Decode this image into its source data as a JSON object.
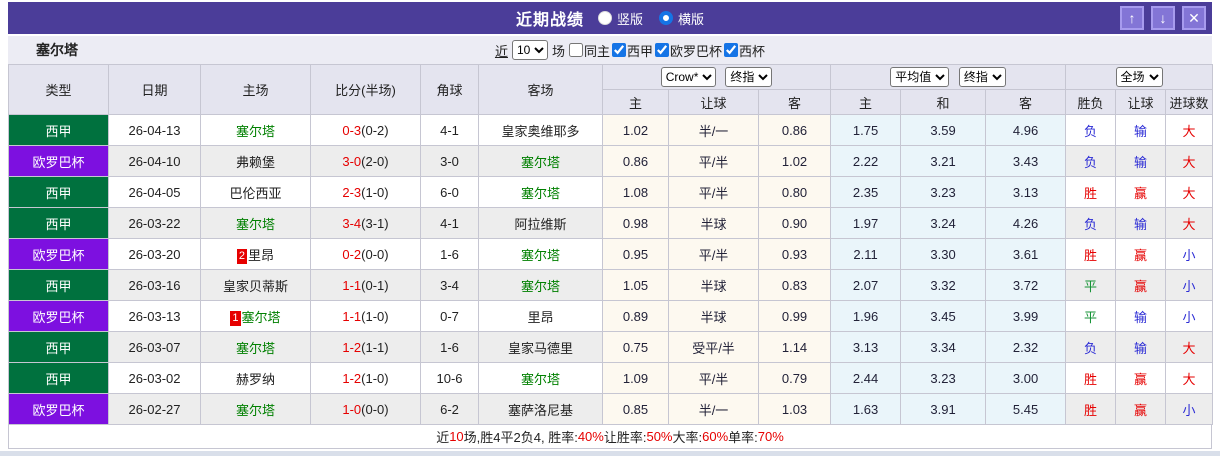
{
  "titlebar": {
    "title": "近期战绩",
    "radios": [
      {
        "label": "竖版",
        "checked": false
      },
      {
        "label": "横版",
        "checked": true
      }
    ],
    "buttons": {
      "up": "↑",
      "down": "↓",
      "close": "✕"
    }
  },
  "filter": {
    "team": "塞尔塔",
    "recent_label": "近",
    "recent_value": "10",
    "games_label": "场",
    "checkboxes": [
      {
        "label": "同主",
        "checked": false
      },
      {
        "label": "西甲",
        "checked": true
      },
      {
        "label": "欧罗巴杯",
        "checked": true
      },
      {
        "label": "西杯",
        "checked": true
      }
    ]
  },
  "table": {
    "headers_left": [
      "类型",
      "日期",
      "主场",
      "比分(半场)",
      "角球",
      "客场"
    ],
    "selects": {
      "crow": "Crow*",
      "final1": "终指",
      "avg": "平均值",
      "final2": "终指",
      "full": "全场"
    },
    "sub_headers": [
      "主",
      "让球",
      "客",
      "主",
      "和",
      "客",
      "胜负",
      "让球",
      "进球数"
    ],
    "league_colors": {
      "西甲": "#00713e",
      "欧罗巴杯": "#7d10e0"
    },
    "result_colors": {
      "red": "#e60000",
      "blue": "#2b2bd5",
      "green": "#149234"
    },
    "team_self_color": "#008000",
    "rows": [
      {
        "league": "西甲",
        "date": "26-04-13",
        "home_rank": "",
        "home": "塞尔塔",
        "home_self": true,
        "score_ft": "0-3",
        "score_ht": "(0-2)",
        "corner": "4-1",
        "away_rank": "",
        "away": "皇家奥维耶多",
        "away_self": false,
        "odds1": [
          "1.02",
          "半/一",
          "0.86"
        ],
        "odds2": [
          "1.75",
          "3.59",
          "4.96"
        ],
        "results": [
          [
            "负",
            "blue"
          ],
          [
            "输",
            "blue"
          ],
          [
            "大",
            "red"
          ]
        ]
      },
      {
        "league": "欧罗巴杯",
        "date": "26-04-10",
        "home_rank": "",
        "home": "弗赖堡",
        "home_self": false,
        "score_ft": "3-0",
        "score_ht": "(2-0)",
        "corner": "3-0",
        "away_rank": "",
        "away": "塞尔塔",
        "away_self": true,
        "odds1": [
          "0.86",
          "平/半",
          "1.02"
        ],
        "odds2": [
          "2.22",
          "3.21",
          "3.43"
        ],
        "results": [
          [
            "负",
            "blue"
          ],
          [
            "输",
            "blue"
          ],
          [
            "大",
            "red"
          ]
        ]
      },
      {
        "league": "西甲",
        "date": "26-04-05",
        "home_rank": "",
        "home": "巴伦西亚",
        "home_self": false,
        "score_ft": "2-3",
        "score_ht": "(1-0)",
        "corner": "6-0",
        "away_rank": "",
        "away": "塞尔塔",
        "away_self": true,
        "odds1": [
          "1.08",
          "平/半",
          "0.80"
        ],
        "odds2": [
          "2.35",
          "3.23",
          "3.13"
        ],
        "results": [
          [
            "胜",
            "red"
          ],
          [
            "赢",
            "red"
          ],
          [
            "大",
            "red"
          ]
        ]
      },
      {
        "league": "西甲",
        "date": "26-03-22",
        "home_rank": "",
        "home": "塞尔塔",
        "home_self": true,
        "score_ft": "3-4",
        "score_ht": "(3-1)",
        "corner": "4-1",
        "away_rank": "",
        "away": "阿拉维斯",
        "away_self": false,
        "odds1": [
          "0.98",
          "半球",
          "0.90"
        ],
        "odds2": [
          "1.97",
          "3.24",
          "4.26"
        ],
        "results": [
          [
            "负",
            "blue"
          ],
          [
            "输",
            "blue"
          ],
          [
            "大",
            "red"
          ]
        ]
      },
      {
        "league": "欧罗巴杯",
        "date": "26-03-20",
        "home_rank": "2",
        "home": "里昂",
        "home_self": false,
        "score_ft": "0-2",
        "score_ht": "(0-0)",
        "corner": "1-6",
        "away_rank": "",
        "away": "塞尔塔",
        "away_self": true,
        "odds1": [
          "0.95",
          "平/半",
          "0.93"
        ],
        "odds2": [
          "2.11",
          "3.30",
          "3.61"
        ],
        "results": [
          [
            "胜",
            "red"
          ],
          [
            "赢",
            "red"
          ],
          [
            "小",
            "blue"
          ]
        ]
      },
      {
        "league": "西甲",
        "date": "26-03-16",
        "home_rank": "",
        "home": "皇家贝蒂斯",
        "home_self": false,
        "score_ft": "1-1",
        "score_ht": "(0-1)",
        "corner": "3-4",
        "away_rank": "",
        "away": "塞尔塔",
        "away_self": true,
        "odds1": [
          "1.05",
          "半球",
          "0.83"
        ],
        "odds2": [
          "2.07",
          "3.32",
          "3.72"
        ],
        "results": [
          [
            "平",
            "green"
          ],
          [
            "赢",
            "red"
          ],
          [
            "小",
            "blue"
          ]
        ]
      },
      {
        "league": "欧罗巴杯",
        "date": "26-03-13",
        "home_rank": "1",
        "home": "塞尔塔",
        "home_self": true,
        "score_ft": "1-1",
        "score_ht": "(1-0)",
        "corner": "0-7",
        "away_rank": "",
        "away": "里昂",
        "away_self": false,
        "odds1": [
          "0.89",
          "半球",
          "0.99"
        ],
        "odds2": [
          "1.96",
          "3.45",
          "3.99"
        ],
        "results": [
          [
            "平",
            "green"
          ],
          [
            "输",
            "blue"
          ],
          [
            "小",
            "blue"
          ]
        ]
      },
      {
        "league": "西甲",
        "date": "26-03-07",
        "home_rank": "",
        "home": "塞尔塔",
        "home_self": true,
        "score_ft": "1-2",
        "score_ht": "(1-1)",
        "corner": "1-6",
        "away_rank": "",
        "away": "皇家马德里",
        "away_self": false,
        "odds1": [
          "0.75",
          "受平/半",
          "1.14"
        ],
        "odds2": [
          "3.13",
          "3.34",
          "2.32"
        ],
        "results": [
          [
            "负",
            "blue"
          ],
          [
            "输",
            "blue"
          ],
          [
            "大",
            "red"
          ]
        ]
      },
      {
        "league": "西甲",
        "date": "26-03-02",
        "home_rank": "",
        "home": "赫罗纳",
        "home_self": false,
        "score_ft": "1-2",
        "score_ht": "(1-0)",
        "corner": "10-6",
        "away_rank": "",
        "away": "塞尔塔",
        "away_self": true,
        "odds1": [
          "1.09",
          "平/半",
          "0.79"
        ],
        "odds2": [
          "2.44",
          "3.23",
          "3.00"
        ],
        "results": [
          [
            "胜",
            "red"
          ],
          [
            "赢",
            "red"
          ],
          [
            "大",
            "red"
          ]
        ]
      },
      {
        "league": "欧罗巴杯",
        "date": "26-02-27",
        "home_rank": "",
        "home": "塞尔塔",
        "home_self": true,
        "score_ft": "1-0",
        "score_ht": "(0-0)",
        "corner": "6-2",
        "away_rank": "",
        "away": "塞萨洛尼基",
        "away_self": false,
        "odds1": [
          "0.85",
          "半/一",
          "1.03"
        ],
        "odds2": [
          "1.63",
          "3.91",
          "5.45"
        ],
        "results": [
          [
            "胜",
            "red"
          ],
          [
            "赢",
            "red"
          ],
          [
            "小",
            "blue"
          ]
        ]
      }
    ]
  },
  "summary": {
    "segments": [
      {
        "text": "近",
        "red": false
      },
      {
        "text": "10",
        "red": true
      },
      {
        "text": "场,胜4平2负4, 胜率:",
        "red": false
      },
      {
        "text": "40%",
        "red": true
      },
      {
        "text": " 让胜率:",
        "red": false
      },
      {
        "text": "50%",
        "red": true
      },
      {
        "text": " 大率:",
        "red": false
      },
      {
        "text": "60%",
        "red": true
      },
      {
        "text": " 单率:",
        "red": false
      },
      {
        "text": "70%",
        "red": true
      }
    ]
  }
}
